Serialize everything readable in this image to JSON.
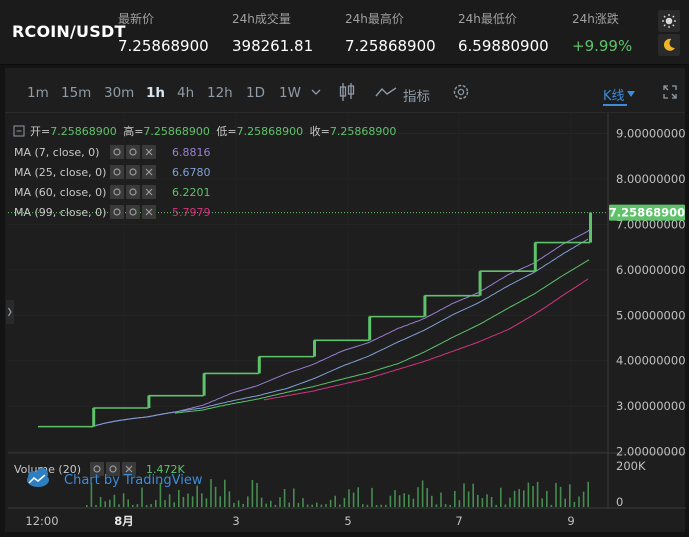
{
  "header": {
    "symbol": "RCOIN/USDT",
    "stats": [
      {
        "label": "最新价",
        "value": "7.25868900"
      },
      {
        "label": "24h成交量",
        "value": "398261.81"
      },
      {
        "label": "24h最高价",
        "value": "7.25868900"
      },
      {
        "label": "24h最低价",
        "value": "6.59880900"
      },
      {
        "label": "24h涨跌",
        "value": "+9.99%"
      }
    ],
    "theme_icons": [
      "sun-icon",
      "moon-icon"
    ]
  },
  "toolbar": {
    "intervals": [
      "1m",
      "15m",
      "30m",
      "1h",
      "4h",
      "12h",
      "1D",
      "1W"
    ],
    "active_interval": "1h",
    "indicators_label": "指标",
    "kline_label": "K线",
    "icons": [
      "chevron-down-icon",
      "candlestick-icon",
      "line-chart-icon",
      "gear-icon",
      "dropdown-arrow-icon",
      "fullscreen-icon"
    ]
  },
  "legend": {
    "ohlc": [
      {
        "label": "开=",
        "value": "7.25868900"
      },
      {
        "label": "高=",
        "value": "7.25868900"
      },
      {
        "label": "低=",
        "value": "7.25868900"
      },
      {
        "label": "收=",
        "value": "7.25868900"
      }
    ],
    "mas": [
      {
        "label": "MA (7, close, 0)",
        "value": "6.8816",
        "color": "#9a7fd6"
      },
      {
        "label": "MA (25, close, 0)",
        "value": "6.6780",
        "color": "#7fa0d6"
      },
      {
        "label": "MA (60, close, 0)",
        "value": "6.2201",
        "color": "#5ec26a"
      },
      {
        "label": "MA (99, close, 0)",
        "value": "5.7979",
        "color": "#d6337f"
      }
    ]
  },
  "volume_legend": {
    "label": "Volume (20)",
    "value": "1.472K"
  },
  "watermark": "Chart by TradingView",
  "colors": {
    "up": "#5ec26a",
    "down": "#e05252",
    "accent": "#3d8bd9",
    "price_line": "#5ec26a"
  },
  "chart_data": {
    "type": "candlestick",
    "price_axis_ticks": [
      "9.00000000",
      "8.00000000",
      "7.00000000",
      "6.00000000",
      "5.00000000",
      "4.00000000",
      "3.00000000",
      "2.00000000"
    ],
    "price_axis_range": [
      1.97,
      9.45
    ],
    "volume_axis_ticks": [
      "200K",
      "0"
    ],
    "time_axis_ticks": [
      "12:00",
      "8月",
      "3",
      "5",
      "7",
      "9"
    ],
    "current_price_label": "7.25868900",
    "current_price": 7.258689,
    "close_levels": [
      2.55,
      2.96,
      3.23,
      3.72,
      4.09,
      4.45,
      4.97,
      5.43,
      5.97,
      6.6,
      7.26
    ],
    "ma_last": {
      "ma7": 6.8816,
      "ma25": 6.678,
      "ma60": 6.2201,
      "ma99": 5.7979
    }
  }
}
